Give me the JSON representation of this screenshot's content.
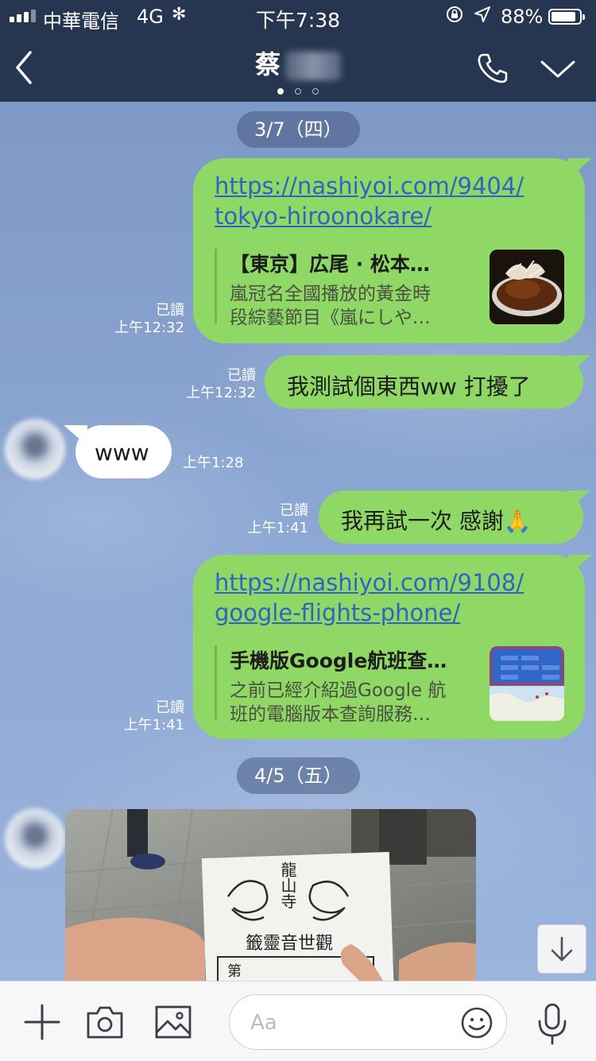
{
  "status_bar": {
    "carrier": "中華電信",
    "network": "4G",
    "time": "下午7:38",
    "battery_percent": "88%",
    "battery_level": 0.88
  },
  "header": {
    "contact_name": "蔡",
    "page_dots_count": 3
  },
  "chat": {
    "date_1": "3/7（四）",
    "msg1": {
      "url_line1": "https://nashiyoi.com/9404/",
      "url_line2": "tokyo-hiroonokare/",
      "preview_title": "【東京】広尾 · 松本…",
      "preview_desc_line1": "嵐冠名全國播放的黃金時",
      "preview_desc_line2": "段綜藝節目《嵐にしや…",
      "read": "已讀",
      "time": "上午12:32"
    },
    "msg2": {
      "text": "我測試個東西ww 打擾了",
      "read": "已讀",
      "time": "上午12:32"
    },
    "msg3": {
      "text": "www",
      "time": "上午1:28"
    },
    "msg4": {
      "text": "我再試一次 感謝🙏",
      "read": "已讀",
      "time": "上午1:41"
    },
    "msg5": {
      "url_line1": "https://nashiyoi.com/9108/",
      "url_line2": "google-flights-phone/",
      "preview_title": "手機版Google航班查…",
      "preview_desc_line1": "之前已經介紹過Google 航",
      "preview_desc_line2": "班的電腦版本查詢服務…",
      "read": "已讀",
      "time": "上午1:41"
    },
    "date_2": "4/5（五）",
    "photo_text": {
      "temple": "龍山寺",
      "title": "籤靈音世觀",
      "col": "第"
    }
  },
  "composer": {
    "placeholder": "Aa"
  },
  "icons": {
    "back": "back-chevron-icon",
    "call": "phone-icon",
    "menu": "chevron-down-icon",
    "plus": "plus-icon",
    "camera": "camera-icon",
    "image": "image-icon",
    "emoji": "emoji-icon",
    "mic": "microphone-icon",
    "scroll": "arrow-down-icon"
  },
  "colors": {
    "header_bg": "#273650",
    "outgoing_bubble": "#8fd865",
    "incoming_bubble": "#ffffff",
    "link": "#2f63c4"
  }
}
